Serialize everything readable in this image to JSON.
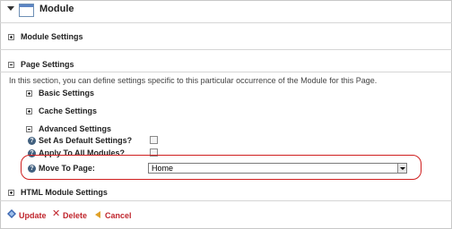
{
  "header": {
    "title": "Module"
  },
  "sections": {
    "module_settings": "Module Settings",
    "page_settings": "Page Settings",
    "page_settings_description": "In this section, you can define settings specific to this particular occurrence of the Module for this Page.",
    "basic_settings": "Basic Settings",
    "cache_settings": "Cache Settings",
    "advanced_settings": "Advanced Settings",
    "html_module_settings": "HTML Module Settings"
  },
  "fields": {
    "set_as_default": {
      "label": "Set As Default Settings?",
      "checked": false
    },
    "apply_to_all": {
      "label": "Apply To All Modules?",
      "checked": false
    },
    "move_to_page": {
      "label": "Move To Page:",
      "value": "Home"
    }
  },
  "actions": {
    "update": "Update",
    "delete": "Delete",
    "cancel": "Cancel"
  },
  "colors": {
    "highlight": "#cf1f1f",
    "action": "#c0262d",
    "help_icon": "#41607f"
  },
  "icons": {
    "expand": "plus-box-icon",
    "collapse": "minus-box-icon",
    "help": "help-icon",
    "module": "module-window-icon",
    "update": "update-icon",
    "delete": "x-icon",
    "cancel": "cancel-arrow-icon"
  }
}
